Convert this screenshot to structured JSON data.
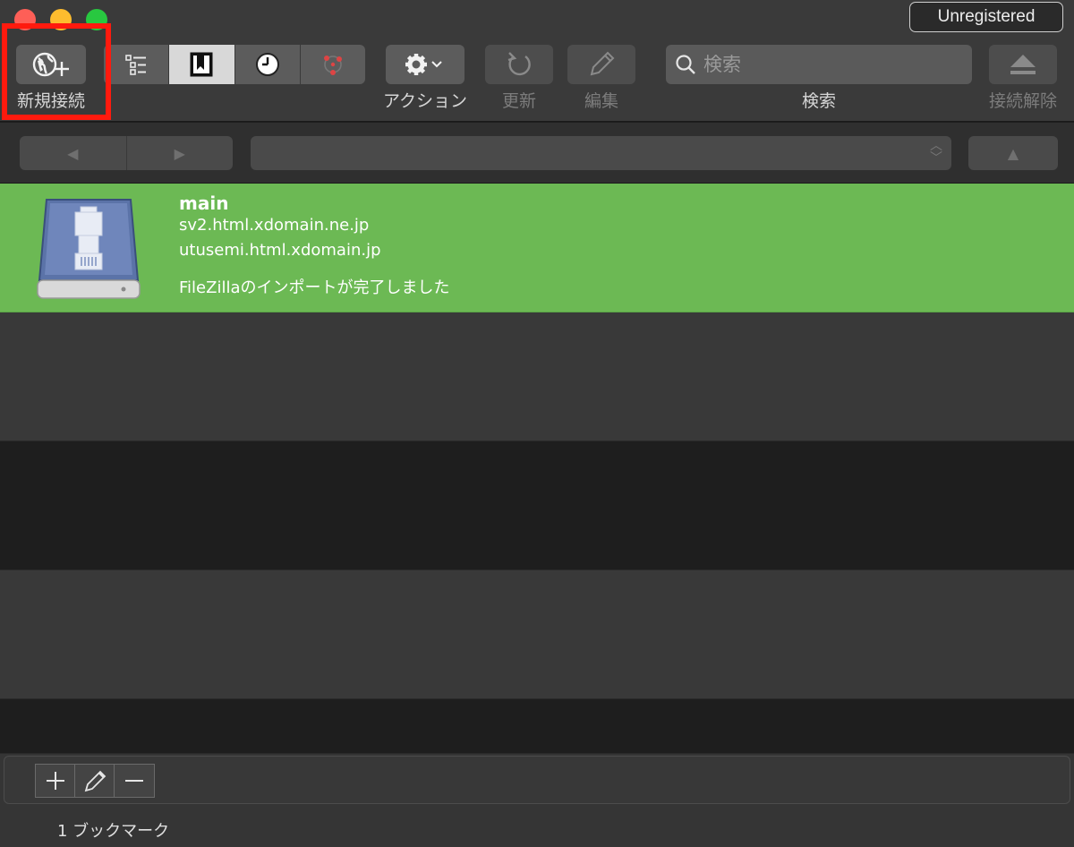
{
  "window": {
    "badge": "Unregistered"
  },
  "toolbar": {
    "new_connection_label": "新規接続",
    "action_label": "アクション",
    "refresh_label": "更新",
    "edit_label": "編集",
    "search_label": "検索",
    "search_placeholder": "検索",
    "disconnect_label": "接続解除",
    "view_segments": [
      {
        "icon": "outline-view-icon",
        "active": false
      },
      {
        "icon": "bookmarks-icon",
        "active": true
      },
      {
        "icon": "history-icon",
        "active": false
      },
      {
        "icon": "bonjour-icon",
        "active": false
      }
    ]
  },
  "bookmarks": [
    {
      "name": "main",
      "lines": [
        "sv2.html.xdomain.ne.jp",
        "utusemi.html.xdomain.jp",
        "FileZillaのインポートが完了しました"
      ],
      "selected": true
    }
  ],
  "footer": {
    "count_label": "1 ブックマーク"
  },
  "colors": {
    "selected_row": "#6cb954",
    "highlight_box": "#ff1a0e"
  }
}
